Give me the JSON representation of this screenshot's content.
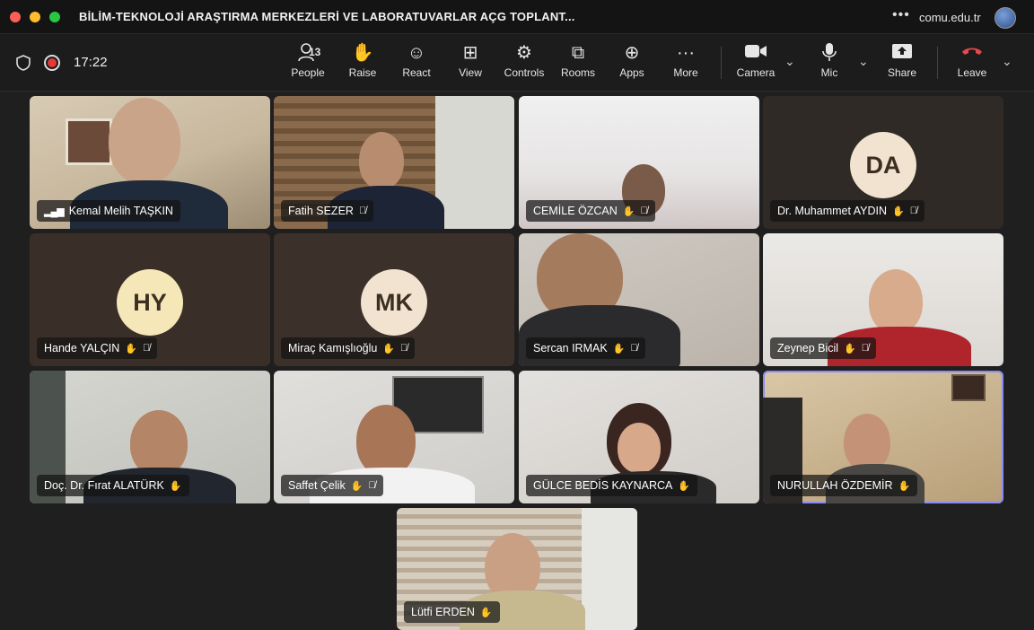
{
  "window": {
    "title": "BİLİM-TEKNOLOJİ ARAŞTIRMA MERKEZLERİ VE LABORATUVARLAR AÇG TOPLANT...",
    "more_icon": "ellipsis-icon",
    "domain": "comu.edu.tr"
  },
  "toolbar": {
    "time": "17:22",
    "people_count": "13",
    "buttons": {
      "people": "People",
      "raise": "Raise",
      "react": "React",
      "view": "View",
      "controls": "Controls",
      "rooms": "Rooms",
      "apps": "Apps",
      "more": "More",
      "camera": "Camera",
      "mic": "Mic",
      "share": "Share",
      "leave": "Leave"
    }
  },
  "participants": [
    {
      "name": "Kemal Melih TAŞKIN",
      "muted": false,
      "signal": true
    },
    {
      "name": "Fatih SEZER",
      "muted": true
    },
    {
      "name": "CEMİLE ÖZCAN",
      "muted": true,
      "raised": true
    },
    {
      "name": "Dr. Muhammet AYDIN",
      "initials": "DA",
      "muted": true,
      "raised": true
    },
    {
      "name": "Hande YALÇIN",
      "initials": "HY",
      "muted": true,
      "raised": true
    },
    {
      "name": "Miraç Kamışlıoğlu",
      "initials": "MK",
      "muted": true,
      "raised": true
    },
    {
      "name": "Sercan IRMAK",
      "muted": true,
      "raised": true
    },
    {
      "name": "Zeynep Bicil",
      "muted": true,
      "raised": true
    },
    {
      "name": "Doç. Dr. Fırat ALATÜRK",
      "muted": false,
      "raised": true
    },
    {
      "name": "Saffet Çelik",
      "muted": true,
      "raised": true
    },
    {
      "name": "GÜLCE BEDİS KAYNARCA",
      "muted": false,
      "raised": true
    },
    {
      "name": "NURULLAH ÖZDEMİR",
      "muted": false,
      "raised": true,
      "active": true
    },
    {
      "name": "Lütfi ERDEN",
      "muted": false,
      "raised": true
    }
  ],
  "colors": {
    "accent_active_border": "#8b8bf5",
    "leave": "#e5484d",
    "record": "#e53935"
  }
}
